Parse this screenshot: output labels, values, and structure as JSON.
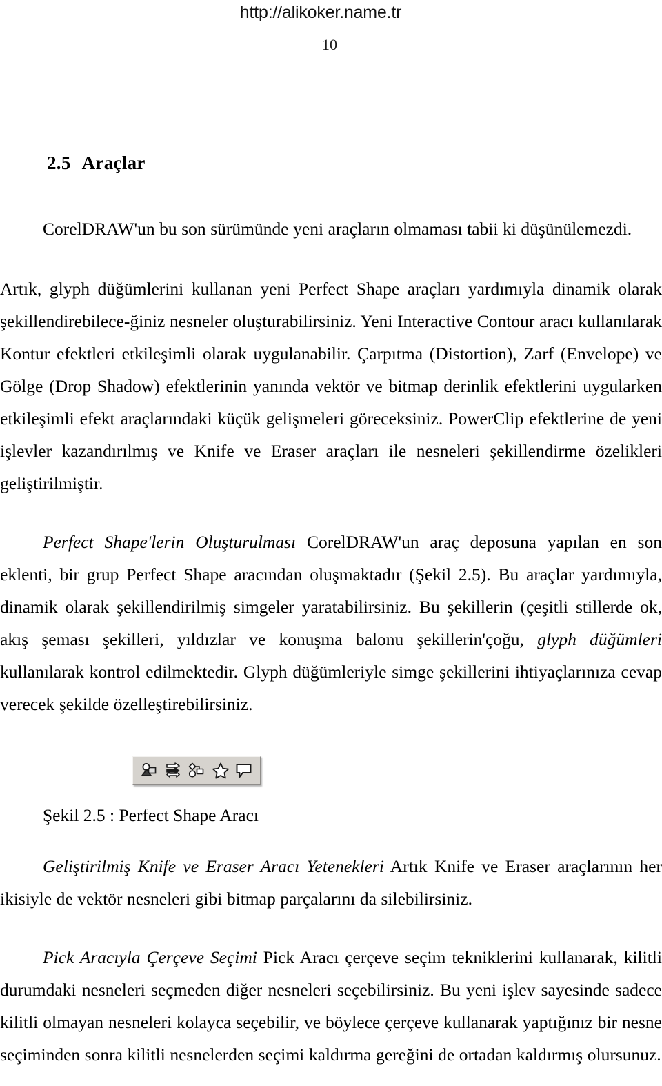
{
  "header": {
    "site_url": "http://alikoker.name.tr",
    "page_number": "10"
  },
  "section": {
    "number": "2.5",
    "title": "Araçlar"
  },
  "paragraphs": {
    "p1": "CorelDRAW'un bu son sürümünde yeni araçların olmaması tabii ki düşünülemezdi.",
    "p2": "Artık, glyph düğümlerini kullanan yeni Perfect Shape araçları yardımıyla dinamik olarak şekillendirebilece-ğiniz nesneler oluşturabilirsiniz. Yeni Interactive Contour aracı kullanılarak Kontur efektleri etkileşimli olarak uygulanabilir. Çarpıtma (Distortion), Zarf (Envelope) ve Gölge (Drop Shadow) efektlerinin yanında vektör ve bitmap derinlik efektlerini uygularken etkileşimli efekt araçlarındaki küçük gelişmeleri göreceksiniz. PowerClip efektlerine de yeni işlevler kazandırılmış ve Knife ve Eraser araçları ile nesneleri şekillendirme özelikleri geliştirilmiştir.",
    "p3_runin": "Perfect Shape'lerin Oluşturulması",
    "p3_a": " CorelDRAW'un araç deposuna yapılan en son eklenti, bir grup Perfect Shape aracından oluşmaktadır (Şekil 2.5). Bu araçlar yardımıyla, dinamik olarak şekillendirilmiş simgeler yaratabilirsiniz. Bu şekillerin (çeşitli stillerde ok, akış şeması şekilleri, yıldızlar ve konuşma balonu şekillerin'çoğu, ",
    "p3_em": "glyph düğümleri",
    "p3_b": " kullanılarak kontrol edilmektedir. Glyph düğümleriyle simge şekillerini ihtiyaçlarınıza cevap verecek şekilde özelleştirebilirsiniz.",
    "p4_runin": "Geliştirilmiş Knife ve Eraser Aracı Yetenekleri",
    "p4_a": " Artık Knife ve Eraser araçlarının her ikisiyle de vektör nesneleri gibi bitmap parçalarını da silebilirsiniz.",
    "p5_runin": "Pick Aracıyla Çerçeve Seçimi",
    "p5_a": " Pick Aracı çerçeve seçim tekniklerini kullanarak, kilitli durumdaki nesneleri seçmeden diğer nesneleri seçebilirsiniz. Bu yeni işlev sayesinde sadece kilitli olmayan nesneleri kolayca seçebilir, ve böylece çerçeve kullanarak yaptığınız bir nesne seçiminden sonra kilitli nesnelerden seçimi kaldırma gereğini de ortadan kaldırmış olursunuz."
  },
  "figure": {
    "caption": "Şekil 2.5 : Perfect Shape Aracı",
    "toolbar_tools": [
      {
        "name": "basic-shapes-tool"
      },
      {
        "name": "arrow-shapes-tool"
      },
      {
        "name": "flowchart-shapes-tool"
      },
      {
        "name": "star-shapes-tool"
      },
      {
        "name": "callout-shapes-tool"
      }
    ],
    "toolbar_background": "#d6d3ce"
  }
}
